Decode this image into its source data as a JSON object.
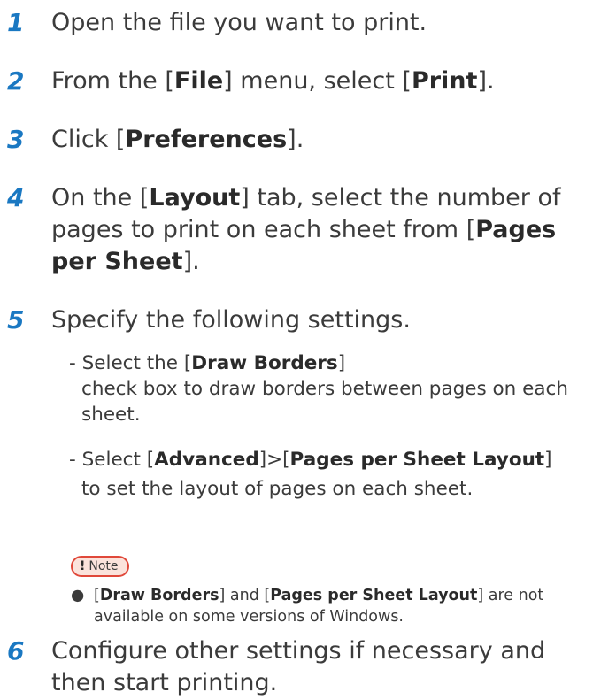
{
  "steps": [
    {
      "num": "1",
      "text": "Open the file you want to print."
    },
    {
      "num": "2",
      "prefix": "From the [",
      "bold1": "File",
      "middle": "] menu, select [",
      "bold2": "Print",
      "suffix": "]."
    },
    {
      "num": "3",
      "prefix": "Click [",
      "bold1": "Preferences",
      "suffix": "]."
    },
    {
      "num": "4",
      "prefix": "On the [",
      "bold1": "Layout",
      "middle": "] tab, select the number of pages to print on each sheet from [",
      "bold2": "Pages per Sheet",
      "suffix": "]."
    },
    {
      "num": "5",
      "text": "Specify the following settings."
    },
    {
      "num": "6",
      "text": "Configure other settings if necessary and then start printing."
    }
  ],
  "substeps": [
    {
      "prefix": "- Select the [",
      "bold1": "Draw Borders",
      "suffix": "]",
      "line2": "check box to draw borders between pages on each sheet."
    },
    {
      "prefix": "- Select [",
      "bold1": "Advanced",
      "middle": "]>[",
      "bold2": "Pages per Sheet Layout",
      "suffix": "]",
      "line2": "to set the layout of pages on each sheet."
    }
  ],
  "note": {
    "badge_icon": "!",
    "badge_label": "Note",
    "bullet": "●",
    "prefix": "[",
    "bold1": "Draw Borders",
    "middle": "] and [",
    "bold2": "Pages per Sheet Layout",
    "suffix": "] are not available on some versions of Windows."
  },
  "colors": {
    "step_number": "#1a78c2",
    "note_border": "#e0483a",
    "note_fill": "#fbe3dc"
  }
}
